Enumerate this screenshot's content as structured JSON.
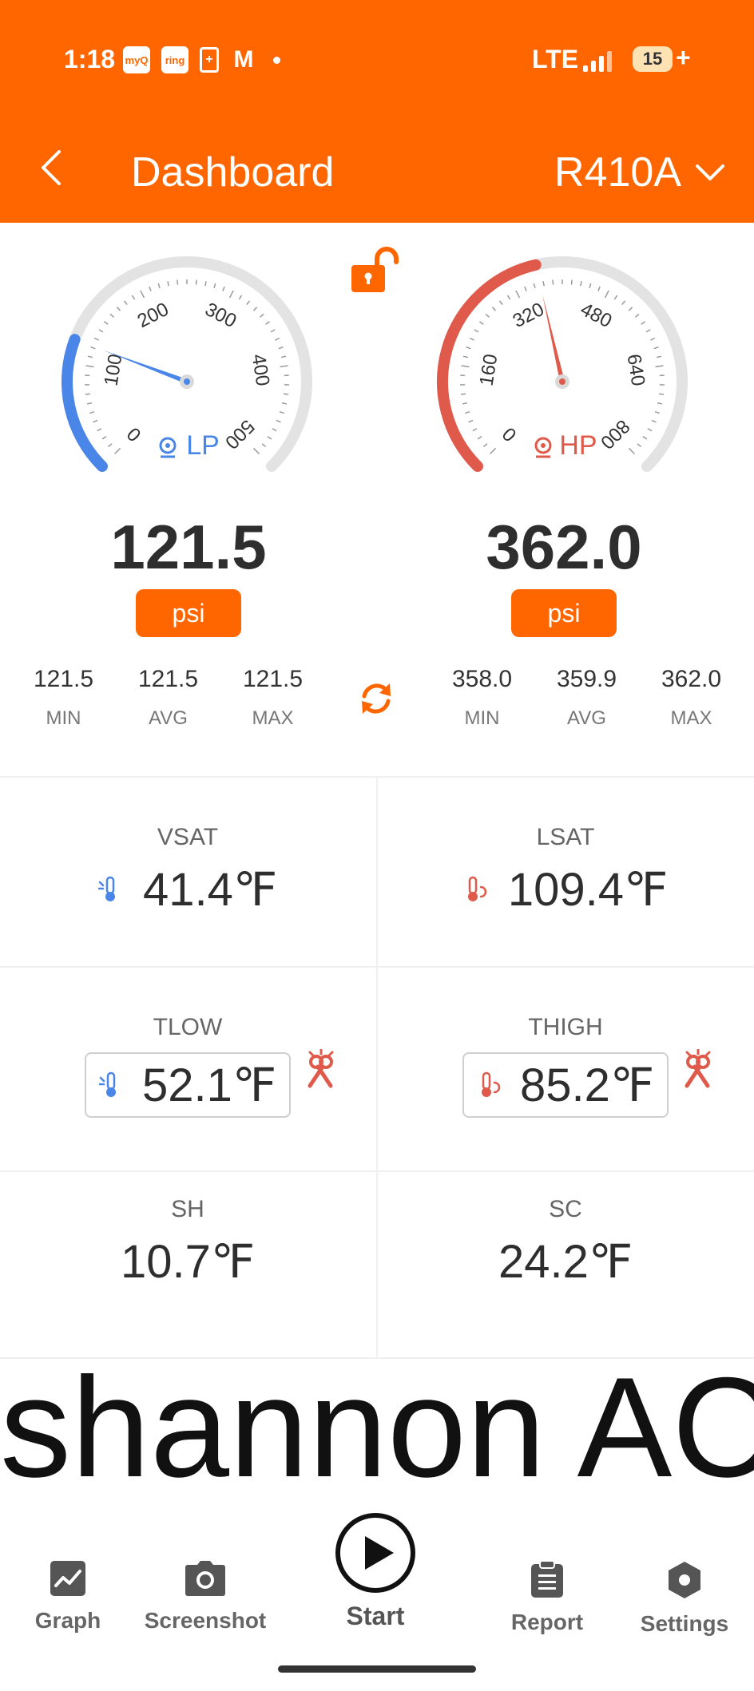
{
  "status_bar": {
    "time": "1:18",
    "notification_icons": [
      "myQ",
      "ring",
      "battery-saver-icon",
      "gmail-icon"
    ],
    "network": "LTE",
    "battery_level": "15",
    "charging_symbol": "+"
  },
  "header": {
    "title": "Dashboard",
    "refrigerant": "R410A"
  },
  "colors": {
    "brand": "#ff6600",
    "lp_blue": "#4a86e8",
    "hp_red": "#e05a4b",
    "track": "#e3e3e3"
  },
  "low_pressure": {
    "label": "LP",
    "value": "121.5",
    "unit": "psi",
    "gauge_min": 0,
    "gauge_max": 500,
    "gauge_ticks": [
      "0",
      "100",
      "200",
      "300",
      "400",
      "500"
    ],
    "stats": {
      "min": "121.5",
      "avg": "121.5",
      "max": "121.5"
    }
  },
  "high_pressure": {
    "label": "HP",
    "value": "362.0",
    "unit": "psi",
    "gauge_min": 0,
    "gauge_max": 800,
    "gauge_ticks": [
      "0",
      "160",
      "320",
      "480",
      "640",
      "800"
    ],
    "stats": {
      "min": "358.0",
      "avg": "359.9",
      "max": "362.0"
    }
  },
  "stat_labels": {
    "min": "MIN",
    "avg": "AVG",
    "max": "MAX"
  },
  "temperatures": {
    "vsat": {
      "label": "VSAT",
      "value": "41.4℉"
    },
    "lsat": {
      "label": "LSAT",
      "value": "109.4℉"
    },
    "tlow": {
      "label": "TLOW",
      "value": "52.1℉"
    },
    "thigh": {
      "label": "THIGH",
      "value": "85.2℉"
    },
    "sh": {
      "label": "SH",
      "value": "10.7℉"
    },
    "sc": {
      "label": "SC",
      "value": "24.2℉"
    }
  },
  "watermark": "shannon AC",
  "nav": {
    "graph": "Graph",
    "screenshot": "Screenshot",
    "start": "Start",
    "report": "Report",
    "settings": "Settings"
  }
}
